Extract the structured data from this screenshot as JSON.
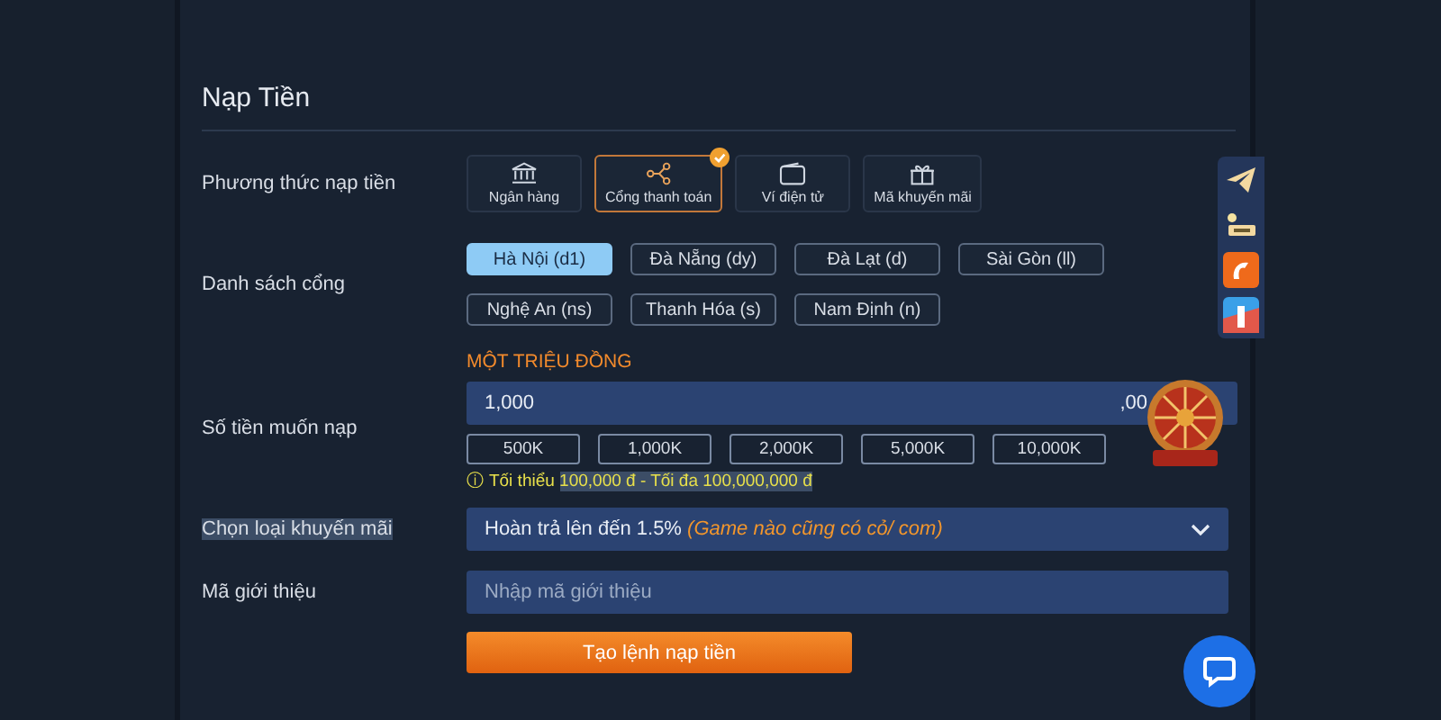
{
  "title": "Nạp Tiền",
  "method_row": {
    "label": "Phương thức nạp tiền",
    "methods": [
      {
        "label": "Ngân hàng",
        "kind": "bank",
        "selected": false
      },
      {
        "label": "Cổng thanh toán",
        "kind": "gateway",
        "selected": true
      },
      {
        "label": "Ví điện tử",
        "kind": "wallet",
        "selected": false
      },
      {
        "label": "Mã khuyến mãi",
        "kind": "gift",
        "selected": false
      }
    ]
  },
  "gate_row": {
    "label": "Danh sách cổng",
    "gates": [
      {
        "label": "Hà Nội (d1)",
        "selected": true
      },
      {
        "label": "Đà Nẵng (dy)",
        "selected": false
      },
      {
        "label": "Đà Lạt (d)",
        "selected": false
      },
      {
        "label": "Sài Gòn (ll)",
        "selected": false
      },
      {
        "label": "Nghệ An (ns)",
        "selected": false
      },
      {
        "label": "Thanh Hóa (s)",
        "selected": false
      },
      {
        "label": "Nam Định (n)",
        "selected": false
      }
    ]
  },
  "amount_row": {
    "label": "Số tiền muốn nạp",
    "amount_words": "MỘT TRIỆU ĐỒNG",
    "value": "1,000",
    "suffix": ",00",
    "chips": [
      {
        "label": "500K"
      },
      {
        "label": "1,000K"
      },
      {
        "label": "2,000K"
      },
      {
        "label": "5,000K"
      },
      {
        "label": "10,000K"
      }
    ],
    "hint": {
      "icon": "ⓘ",
      "text": "Tối thiểu ",
      "selected_text": "100,000 đ - Tối đa 100,000,000 đ"
    }
  },
  "promo_row": {
    "label": "Chọn loại khuyến mãi",
    "label_selected": true,
    "value": "Hoàn trả lên đến 1.5%",
    "note": "(Game nào cũng có cỏ/ com)"
  },
  "referral_row": {
    "label": "Mã giới thiệu",
    "placeholder": "Nhập mã giới thiệu"
  },
  "submit": "Tạo lệnh nạp tiền",
  "side_tools": [
    {
      "kind": "telegram"
    },
    {
      "kind": "money"
    },
    {
      "kind": "orange-app"
    },
    {
      "kind": "blue-app"
    }
  ]
}
